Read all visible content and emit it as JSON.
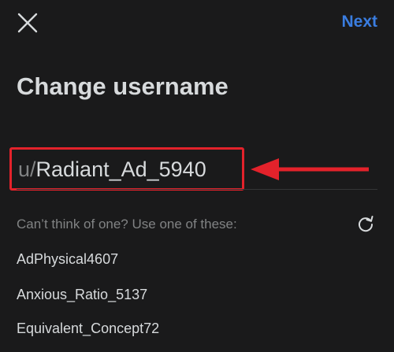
{
  "header": {
    "next_label": "Next"
  },
  "main": {
    "title": "Change username",
    "username_prefix": "u/",
    "username_value": "Radiant_Ad_5940",
    "suggestions_label": "Can’t think of one? Use one of these:",
    "suggestions": [
      "AdPhysical4607",
      "Anxious_Ratio_5137",
      "Equivalent_Concept72"
    ]
  },
  "colors": {
    "accent": "#3a7de0",
    "highlight": "#e3222b",
    "background": "#1a1a1b"
  },
  "icons": {
    "close": "close-icon",
    "refresh": "refresh-icon",
    "annotation": "arrow-left-icon"
  }
}
